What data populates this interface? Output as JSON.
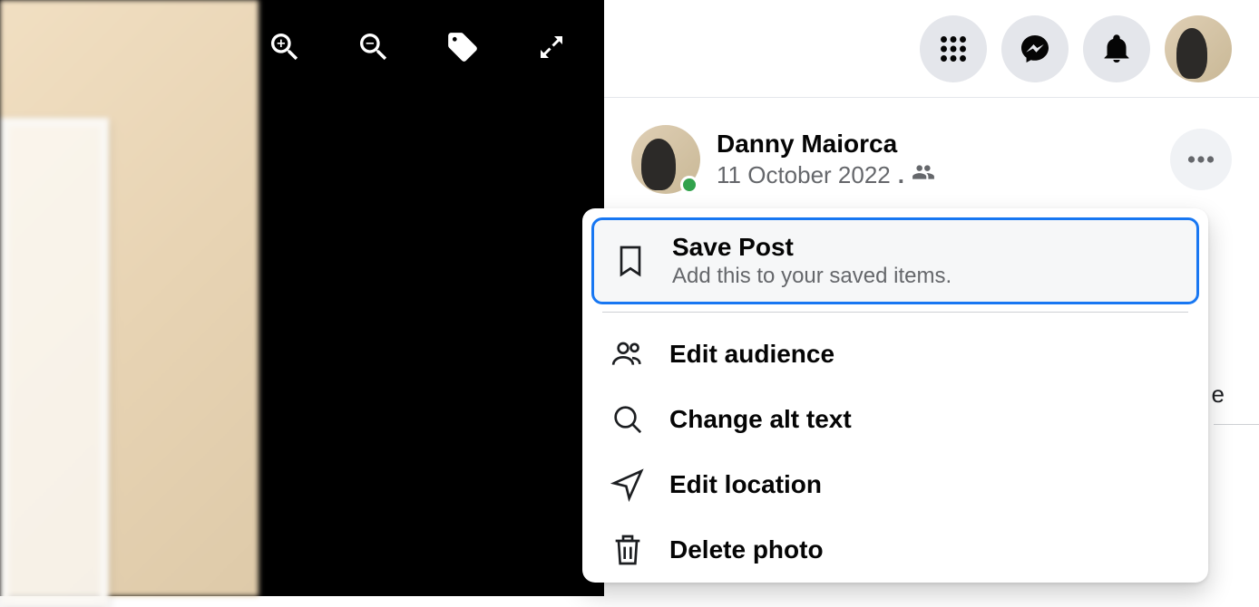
{
  "post": {
    "author_name": "Danny Maiorca",
    "date": "11 October 2022",
    "audience_icon": "friends-icon"
  },
  "menu": {
    "save": {
      "title": "Save Post",
      "subtitle": "Add this to your saved items."
    },
    "edit_audience": "Edit audience",
    "change_alt": "Change alt text",
    "edit_location": "Edit location",
    "delete_photo": "Delete photo"
  },
  "behind_menu_fragment": "e"
}
